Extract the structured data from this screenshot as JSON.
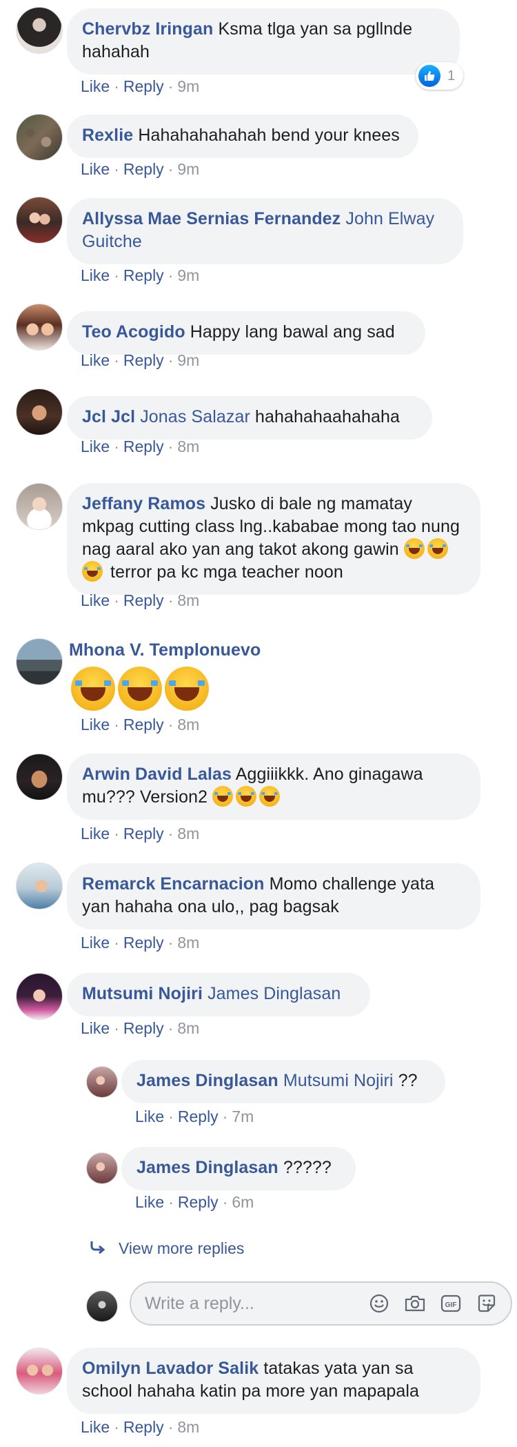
{
  "actions": {
    "like": "Like",
    "reply": "Reply",
    "sep": "·"
  },
  "comments": [
    {
      "author": "Chervbz Iringan",
      "text": "Ksma tlga yan sa pgllnde hahahah",
      "time": "9m",
      "reaction_count": "1"
    },
    {
      "author": "Rexlie",
      "text": "Hahahahahahah bend your knees",
      "time": "9m"
    },
    {
      "author": "Allyssa Mae Sernias Fernandez",
      "mention": "John Elway Guitche",
      "time": "9m"
    },
    {
      "author": "Teo Acogido",
      "text": "Happy lang bawal ang sad",
      "time": "9m"
    },
    {
      "author": "Jcl Jcl",
      "mention": "Jonas Salazar",
      "text": "hahahahaahahaha",
      "time": "8m"
    },
    {
      "author": "Jeffany Ramos",
      "text": "Jusko di bale ng mamatay mkpag cutting class lng..kababae mong tao nung nag aaral ako yan ang takot akong gawin",
      "text_after": "terror pa kc mga teacher noon",
      "time": "8m"
    },
    {
      "author": "Mhona V. Templonuevo",
      "time": "8m"
    },
    {
      "author": "Arwin David Lalas",
      "text": "Aggiiikkk. Ano ginagawa mu??? Version2",
      "time": "8m"
    },
    {
      "author": "Remarck Encarnacion",
      "text": "Momo challenge yata yan hahaha ona ulo,, pag bagsak",
      "time": "8m"
    },
    {
      "author": "Mutsumi Nojiri",
      "mention": "James Dinglasan",
      "time": "8m"
    },
    {
      "author": "Omilyn Lavador Salik",
      "text": "tatakas yata yan sa school hahaha katin pa more yan mapapala",
      "time": "8m"
    }
  ],
  "replies": [
    {
      "author": "James Dinglasan",
      "mention": "Mutsumi Nojiri",
      "text": "??",
      "time": "7m"
    },
    {
      "author": "James Dinglasan",
      "text": "?????",
      "time": "6m"
    }
  ],
  "view_more_replies": "View more replies",
  "reply_box": {
    "placeholder": "Write a reply..."
  },
  "colors": {
    "link": "#385898",
    "meta": "#90949c",
    "bubble": "#f2f3f5",
    "like_blue": "#1877f2"
  },
  "icons": [
    "thumbs-up-icon",
    "reply-arrow-icon",
    "emoji-icon",
    "camera-icon",
    "gif-icon",
    "sticker-icon",
    "laughing-emoji-icon"
  ]
}
